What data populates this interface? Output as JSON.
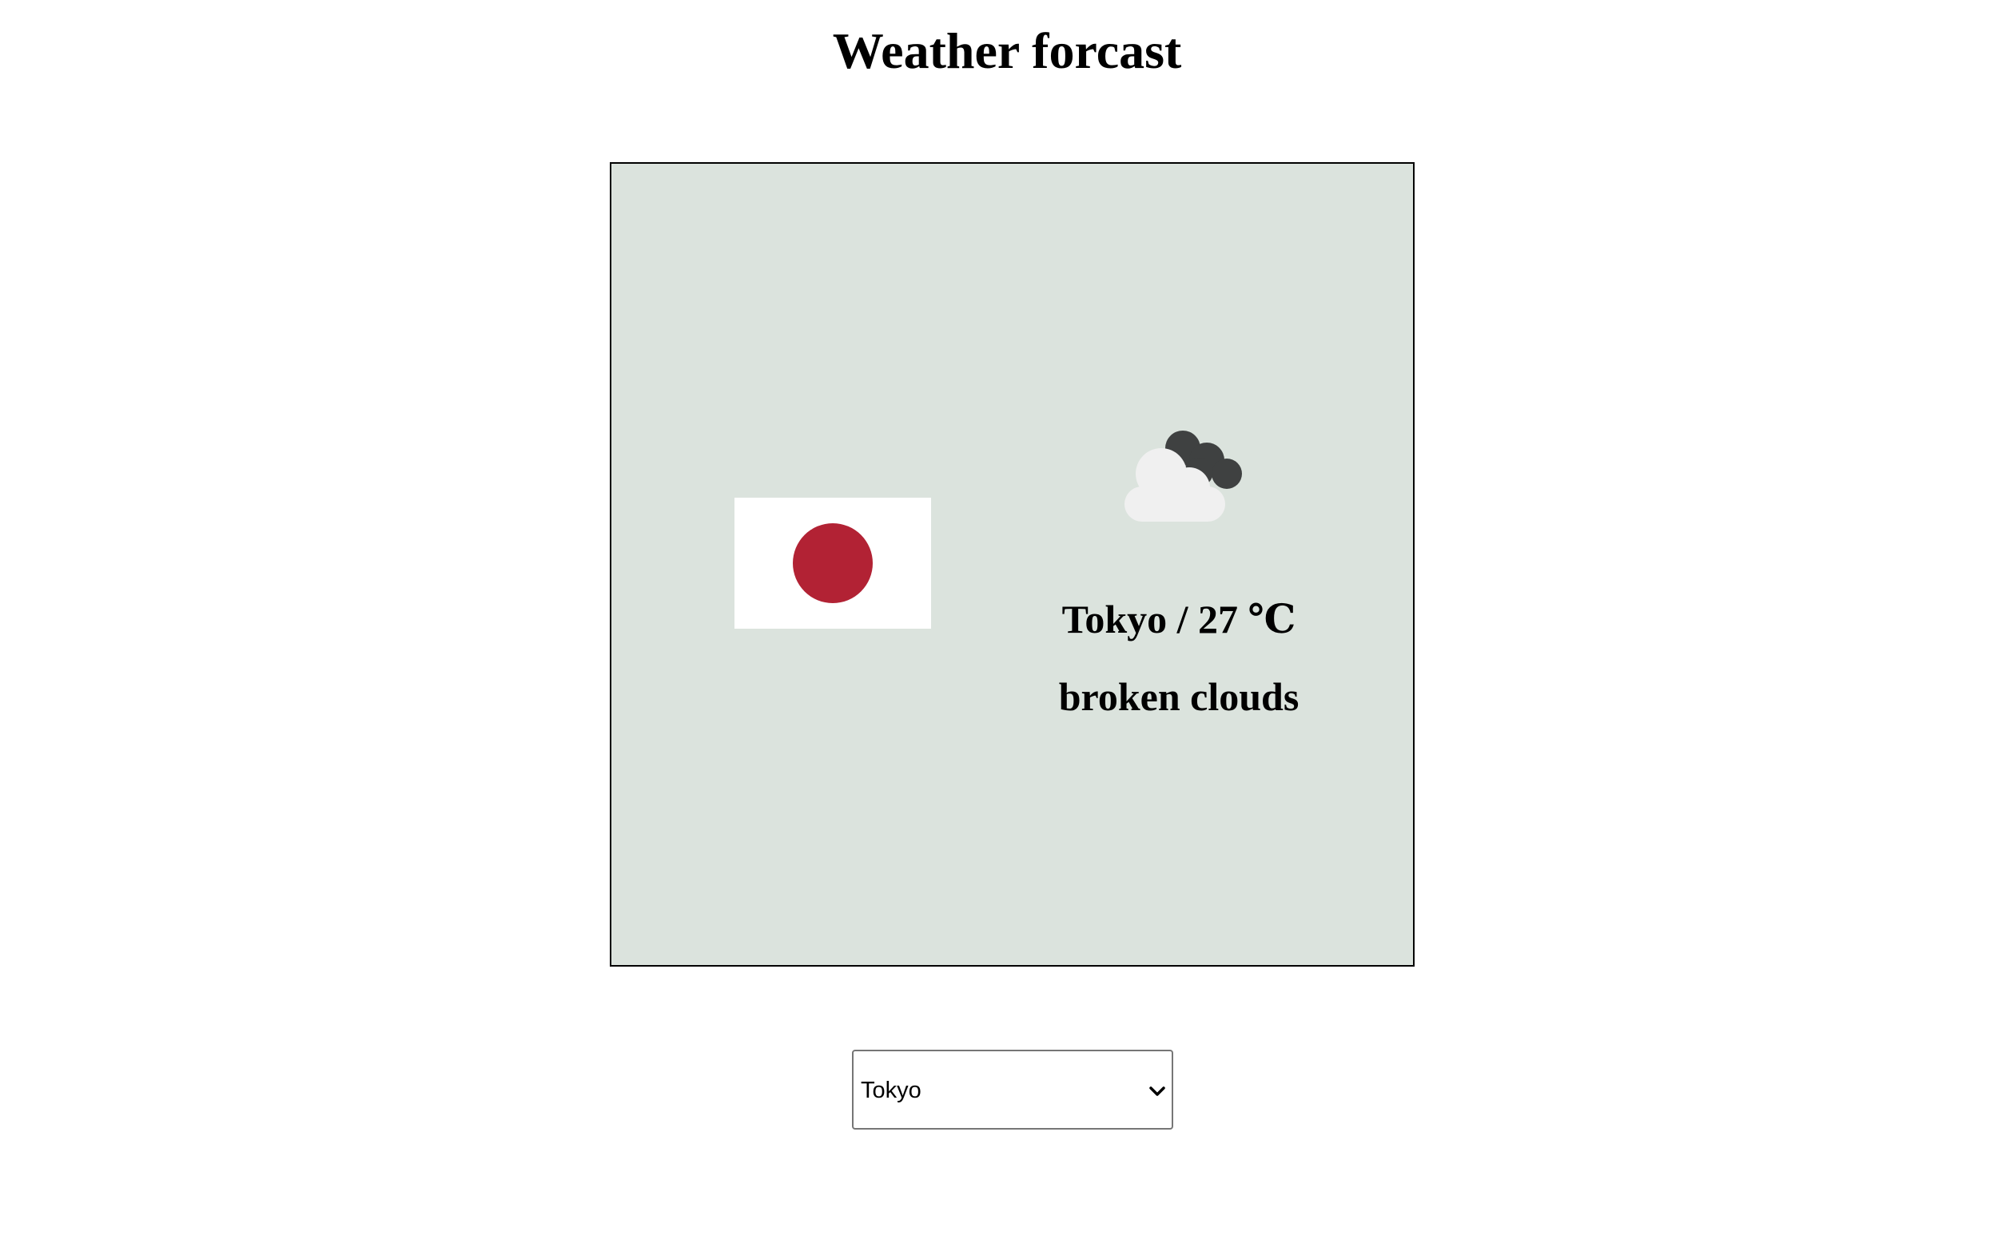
{
  "page": {
    "title": "Weather forcast"
  },
  "card": {
    "background": "#dbe3dd",
    "flag": {
      "icon": "japan-flag-icon",
      "field_color": "#ffffff",
      "disc_color": "#b22234"
    },
    "weather": {
      "icon": "broken-clouds-icon",
      "city_temp": "Tokyo / 27 ℃",
      "description": "broken clouds"
    }
  },
  "city_select": {
    "selected": "Tokyo"
  }
}
